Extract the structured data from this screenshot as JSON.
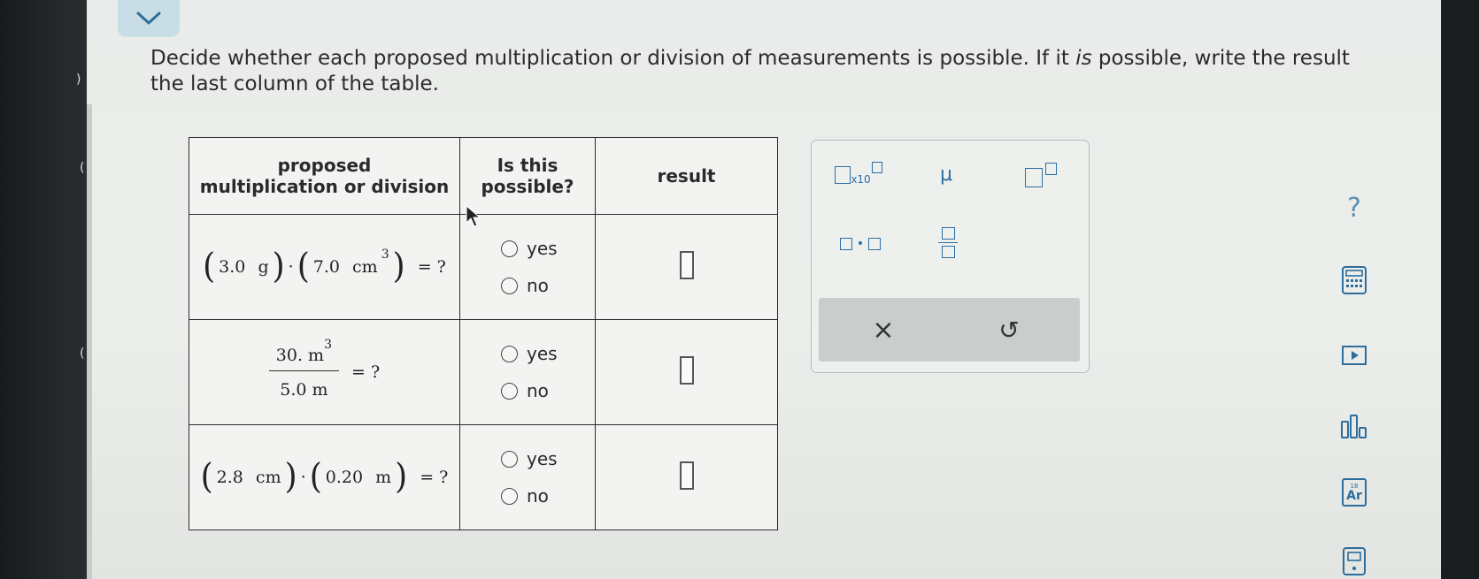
{
  "colors": {
    "accent": "#2a6fa6",
    "collapse_button_bg": "#c8dde6"
  },
  "instructions": {
    "line1_a": "Decide whether each proposed multiplication or division of measurements is possible. If it ",
    "line1_em": "is",
    "line1_b": " possible, write the result ",
    "line2": "the last column of the table."
  },
  "table": {
    "headers": {
      "col1_line1": "proposed",
      "col1_line2": "multiplication or division",
      "col2_line1": "Is this",
      "col2_line2": "possible?",
      "col3": "result"
    },
    "rows": [
      {
        "a_val": "3.0",
        "a_unit": "g",
        "b_val": "7.0",
        "b_unit": "cm",
        "b_exp": "3",
        "dot": "·",
        "eq": "= ?",
        "yes": "yes",
        "no": "no"
      },
      {
        "num_val": "30.",
        "num_unit": "m",
        "num_exp": "3",
        "den_val": "5.0",
        "den_unit": "m",
        "eq": "= ?",
        "yes": "yes",
        "no": "no"
      },
      {
        "a_val": "2.8",
        "a_unit": "cm",
        "b_val": "0.20",
        "b_unit": "m",
        "dot": "·",
        "eq": "= ?",
        "yes": "yes",
        "no": "no"
      }
    ]
  },
  "palette": {
    "sci_notation_label": "x10",
    "mu_label": "μ",
    "dot_label": "•",
    "clear_label": "×",
    "undo_label": "↺"
  },
  "toolbar": {
    "help_label": "?",
    "periodic_label": "Ar",
    "periodic_number": "18"
  },
  "bezel": {
    "left_marks": [
      ")",
      "(",
      "("
    ]
  }
}
